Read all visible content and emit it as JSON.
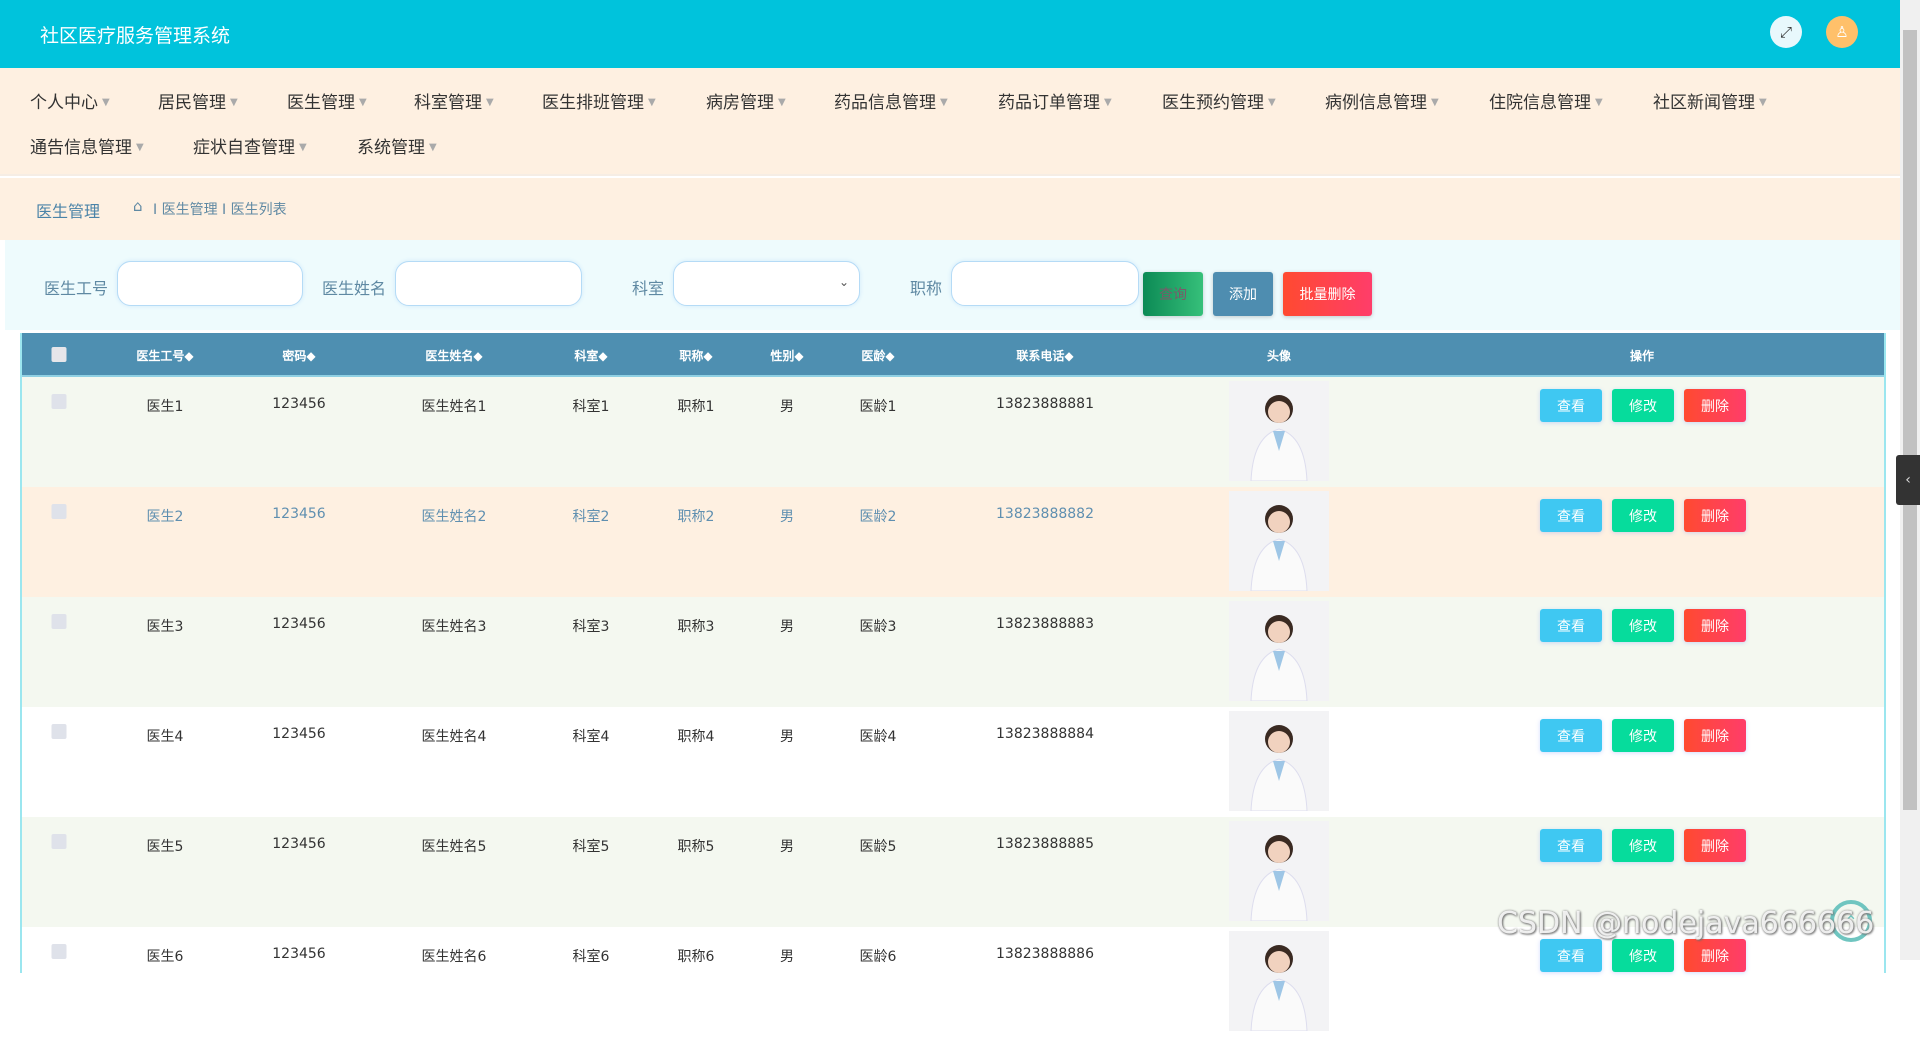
{
  "header": {
    "title": "社区医疗服务管理系统",
    "fullscreen_icon": "expand-icon",
    "user_icon": "user-icon"
  },
  "nav": [
    {
      "label": "个人中心"
    },
    {
      "label": "居民管理"
    },
    {
      "label": "医生管理"
    },
    {
      "label": "科室管理"
    },
    {
      "label": "医生排班管理"
    },
    {
      "label": "病房管理"
    },
    {
      "label": "药品信息管理"
    },
    {
      "label": "药品订单管理"
    },
    {
      "label": "医生预约管理"
    },
    {
      "label": "病例信息管理"
    },
    {
      "label": "住院信息管理"
    },
    {
      "label": "社区新闻管理"
    },
    {
      "label": "通告信息管理"
    },
    {
      "label": "症状自查管理"
    },
    {
      "label": "系统管理"
    }
  ],
  "breadcrumb": {
    "title": "医生管理",
    "path": "I 医生管理 I 医生列表"
  },
  "search": {
    "labels": [
      "医生工号",
      "医生姓名",
      "科室",
      "职称"
    ],
    "values": [
      "",
      "",
      "",
      ""
    ],
    "query": "查询",
    "add": "添加",
    "batch_delete": "批量删除"
  },
  "table": {
    "headers": [
      "医生工号◆",
      "密码◆",
      "医生姓名◆",
      "科室◆",
      "职称◆",
      "性别◆",
      "医龄◆",
      "联系电话◆",
      "头像",
      "操作"
    ],
    "actions": {
      "view": "查看",
      "edit": "修改",
      "delete": "删除"
    },
    "rows": [
      [
        "医生1",
        "123456",
        "医生姓名1",
        "科室1",
        "职称1",
        "男",
        "医龄1",
        "13823888881"
      ],
      [
        "医生2",
        "123456",
        "医生姓名2",
        "科室2",
        "职称2",
        "男",
        "医龄2",
        "13823888882"
      ],
      [
        "医生3",
        "123456",
        "医生姓名3",
        "科室3",
        "职称3",
        "男",
        "医龄3",
        "13823888883"
      ],
      [
        "医生4",
        "123456",
        "医生姓名4",
        "科室4",
        "职称4",
        "男",
        "医龄4",
        "13823888884"
      ],
      [
        "医生5",
        "123456",
        "医生姓名5",
        "科室5",
        "职称5",
        "男",
        "医龄5",
        "13823888885"
      ],
      [
        "医生6",
        "123456",
        "医生姓名6",
        "科室6",
        "职称6",
        "男",
        "医龄6",
        "13823888886"
      ]
    ]
  },
  "colors": {
    "header": "#00c3dc",
    "nav_bg": "#fef0e1",
    "table_head": "#4e8fb1",
    "view": "#3fc8f2",
    "edit": "#06dc9c",
    "delete": "#ff4a3a"
  },
  "watermark": "CSDN @nodejava666666"
}
